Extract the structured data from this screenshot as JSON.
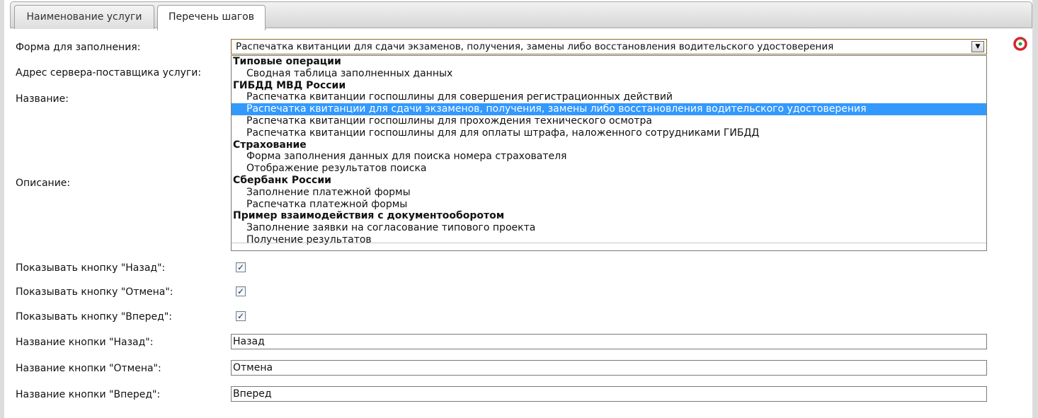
{
  "tabs": [
    {
      "label": "Наименование услуги",
      "active": false
    },
    {
      "label": "Перечень шагов",
      "active": true
    }
  ],
  "form": {
    "form_label": "Форма для заполнения:",
    "server_label": "Адрес сервера-поставщика услуги:",
    "name_label": "Название:",
    "description_label": "Описание:",
    "selected_form": "Распечатка квитанции для сдачи экзаменов, получения, замены либо восстановления водительского удостоверения"
  },
  "dropdown": {
    "groups": [
      {
        "title": "Типовые операции",
        "options": [
          "Сводная таблица заполненных данных"
        ]
      },
      {
        "title": "ГИБДД МВД России",
        "options": [
          "Распечатка квитанции госпошлины для совершения регистрационных действий",
          "Распечатка квитанции для сдачи экзаменов, получения, замены либо восстановления водительского удостоверения",
          "Распечатка квитанции госпошлины для прохождения технического осмотра",
          "Распечатка квитанции госпошлины для для оплаты штрафа, наложенного сотрудниками ГИБДД"
        ]
      },
      {
        "title": "Страхование",
        "options": [
          "Форма заполнения данных для поиска номера страхователя",
          "Отображение результатов поиска"
        ]
      },
      {
        "title": "Сбербанк России",
        "options": [
          "Заполнение платежной формы",
          "Распечатка платежной формы"
        ]
      },
      {
        "title": "Пример взаимодействия с документооборотом",
        "options": [
          "Заполнение заявки на согласование типового проекта",
          "Получение результатов"
        ]
      }
    ]
  },
  "checkboxes": [
    {
      "label": "Показывать кнопку \"Назад\":",
      "checked": true
    },
    {
      "label": "Показывать кнопку \"Отмена\":",
      "checked": true
    },
    {
      "label": "Показывать кнопку \"Вперед\":",
      "checked": true
    }
  ],
  "button_names": [
    {
      "label": "Название кнопки \"Назад\":",
      "value": "Назад"
    },
    {
      "label": "Название кнопки \"Отмена\":",
      "value": "Отмена"
    },
    {
      "label": "Название кнопки \"Вперед\":",
      "value": "Вперед"
    }
  ],
  "icons": {
    "help": "help-lifebuoy-icon"
  },
  "colors": {
    "selection": "#3399ff",
    "help_red": "#d8232a",
    "help_green": "#3a9a3a"
  }
}
